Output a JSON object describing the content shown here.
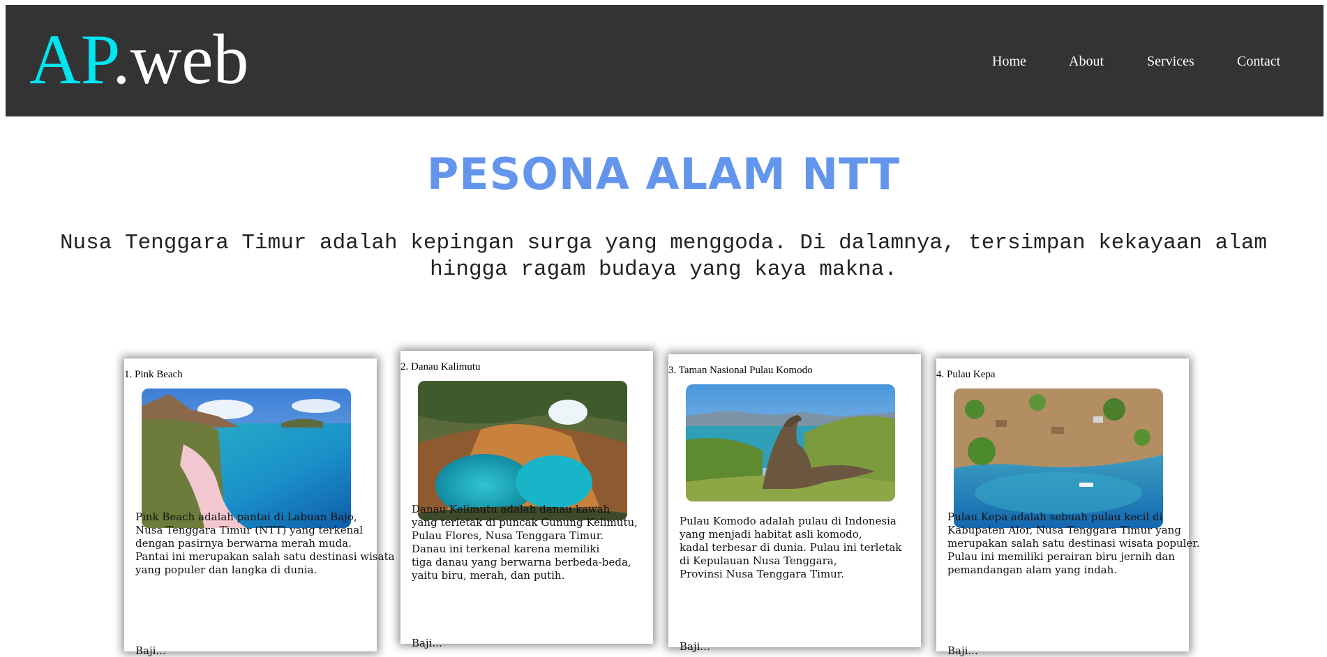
{
  "brand": {
    "logo_accent": "AP",
    "logo_rest": ".web",
    "accent_color": "#00e5f0"
  },
  "nav": {
    "items": [
      {
        "label": "Home"
      },
      {
        "label": "About"
      },
      {
        "label": "Services"
      },
      {
        "label": "Contact"
      }
    ]
  },
  "hero": {
    "title": "PESONA ALAM NTT",
    "title_color": "#6495ed",
    "description": "Nusa Tenggara Timur adalah kepingan surga yang menggoda. Di dalamnya, tersimpan kekayaan alam hingga ragam budaya yang kaya makna."
  },
  "cards": [
    {
      "title": "1. Pink Beach",
      "image": "pink-beach-photo",
      "lines": [
        "Pink Beach adalah pantai di Labuan Bajo,",
        "Nusa Tenggara Timur (NTT) yang terkenal",
        "dengan pasirnya berwarna merah muda.",
        "Pantai ini merupakan salah satu destinasi wisata",
        "yang populer dan langka di dunia."
      ],
      "more": "Baji..."
    },
    {
      "title": "2. Danau Kalimutu",
      "image": "danau-kelimutu-photo",
      "lines": [
        "Danau Kelimutu adalah danau kawah",
        "yang terletak di puncak Gunung Kelimutu,",
        "Pulau Flores, Nusa Tenggara Timur.",
        "Danau ini terkenal karena memiliki",
        "tiga danau yang berwarna berbeda-beda,",
        "yaitu biru, merah, dan putih."
      ],
      "more": "Baji..."
    },
    {
      "title": "3. Taman Nasional Pulau Komodo",
      "image": "komodo-photo",
      "lines": [
        "Pulau Komodo adalah pulau di Indonesia",
        "yang menjadi habitat asli komodo,",
        "kadal terbesar di dunia. Pulau ini terletak",
        "di Kepulauan Nusa Tenggara,",
        "Provinsi Nusa Tenggara Timur."
      ],
      "more": "Baji..."
    },
    {
      "title": "4. Pulau Kepa",
      "image": "pulau-kepa-photo",
      "lines": [
        "Pulau Kepa adalah sebuah pulau kecil di",
        "Kabupaten Alor, Nusa Tenggara Timur yang",
        "merupakan salah satu destinasi wisata populer.",
        "Pulau ini memiliki perairan biru jernih dan",
        "pemandangan alam yang indah."
      ],
      "more": "Baji..."
    }
  ]
}
